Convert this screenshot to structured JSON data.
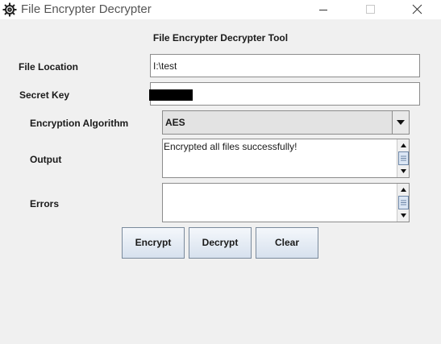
{
  "window": {
    "title": "File Encrypter Decrypter",
    "icon": "gear-icon",
    "controls": {
      "minimize": "minimize-icon",
      "maximize": "maximize-icon",
      "close": "close-icon"
    }
  },
  "form": {
    "heading": "File Encrypter Decrypter Tool",
    "file_location": {
      "label": "File Location",
      "value": "I:\\test"
    },
    "secret_key": {
      "label": "Secret Key",
      "masked": true
    },
    "algorithm": {
      "label": "Encryption Algorithm",
      "selected": "AES"
    },
    "output": {
      "label": "Output",
      "text": "Encrypted all files successfully!"
    },
    "errors": {
      "label": "Errors",
      "text": ""
    }
  },
  "buttons": {
    "encrypt": "Encrypt",
    "decrypt": "Decrypt",
    "clear": "Clear"
  },
  "colors": {
    "window_bg": "#f0f0f0",
    "button_gradient_top": "#f4f7fb",
    "button_gradient_bottom": "#d7e1ee",
    "field_border": "#8c8c8c"
  }
}
